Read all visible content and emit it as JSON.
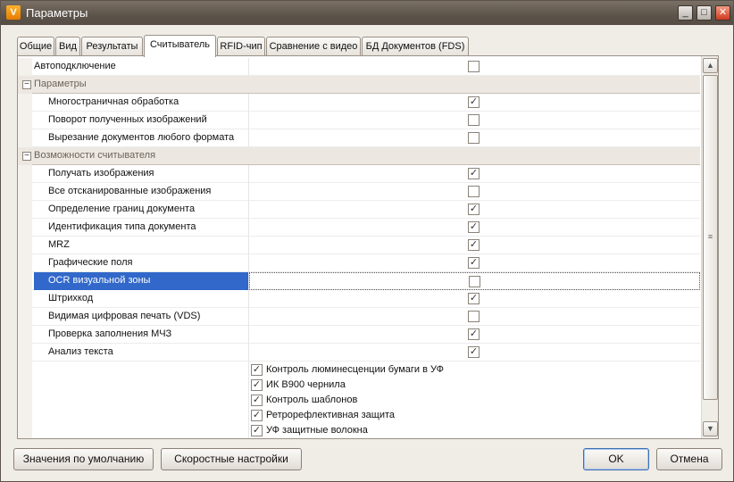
{
  "window": {
    "title": "Параметры",
    "app_icon_glyph": "V"
  },
  "tabs": [
    {
      "label": "Общие"
    },
    {
      "label": "Вид"
    },
    {
      "label": "Результаты"
    },
    {
      "label": "Считыватель"
    },
    {
      "label": "RFID-чип"
    },
    {
      "label": "Сравнение с видео"
    },
    {
      "label": "БД Документов (FDS)"
    }
  ],
  "active_tab": "Считыватель",
  "grid": {
    "top_item": {
      "label": "Автоподключение",
      "checked": false
    },
    "cat1": {
      "label": "Параметры"
    },
    "cat1_items": [
      {
        "label": "Многостраничная обработка",
        "checked": true
      },
      {
        "label": "Поворот полученных изображений",
        "checked": false
      },
      {
        "label": "Вырезание документов любого формата",
        "checked": false
      }
    ],
    "cat2": {
      "label": "Возможности считывателя"
    },
    "cat2_items": [
      {
        "label": "Получать изображения",
        "checked": true
      },
      {
        "label": "Все отсканированные изображения",
        "checked": false
      },
      {
        "label": "Определение границ документа",
        "checked": true
      },
      {
        "label": "Идентификация типа документа",
        "checked": true
      },
      {
        "label": "MRZ",
        "checked": true
      },
      {
        "label": "Графические поля",
        "checked": true
      },
      {
        "label": "OCR визуальной зоны",
        "checked": false,
        "selected": true
      },
      {
        "label": "Штрихкод",
        "checked": true
      },
      {
        "label": "Видимая цифровая печать (VDS)",
        "checked": false
      },
      {
        "label": "Проверка заполнения МЧЗ",
        "checked": true
      },
      {
        "label": "Анализ текста",
        "checked": true
      }
    ],
    "auth_checks": [
      {
        "label": "Контроль люминесценции бумаги в УФ",
        "checked": true
      },
      {
        "label": "ИК B900 чернила",
        "checked": true
      },
      {
        "label": "Контроль шаблонов",
        "checked": true
      },
      {
        "label": "Ретрорефлективная защита",
        "checked": true
      },
      {
        "label": "УФ защитные волокна",
        "checked": true
      }
    ]
  },
  "footer": {
    "defaults_label": "Значения по умолчанию",
    "speed_label": "Скоростные настройки",
    "ok_label": "OK",
    "cancel_label": "Отмена"
  },
  "glyphs": {
    "check": "✓",
    "collapse": "−",
    "scroll_up": "▲",
    "scroll_down": "▼",
    "thumb_grip": "≡",
    "minimize": "_",
    "maximize": "□",
    "close": "✕"
  }
}
